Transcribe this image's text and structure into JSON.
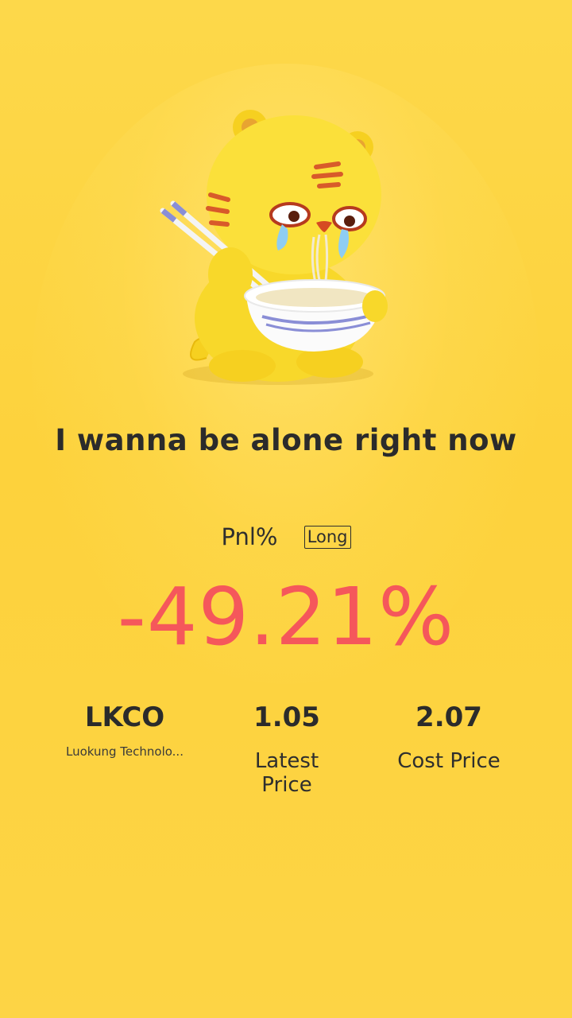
{
  "headline": "I wanna be alone right now",
  "pnl": {
    "label": "Pnl%",
    "badge": "Long",
    "value": "-49.21%",
    "value_color": "#f5575b"
  },
  "stats": {
    "symbol": "LKCO",
    "company": "Luokung Technolo...",
    "latest_price": "1.05",
    "latest_price_label": "Latest Price",
    "cost_price": "2.07",
    "cost_price_label": "Cost Price"
  },
  "mascot": {
    "icon": "crying-tiger-eating-noodles-icon"
  },
  "colors": {
    "background": "#fdd23c",
    "text": "#2b2b2b",
    "loss": "#f5575b"
  }
}
